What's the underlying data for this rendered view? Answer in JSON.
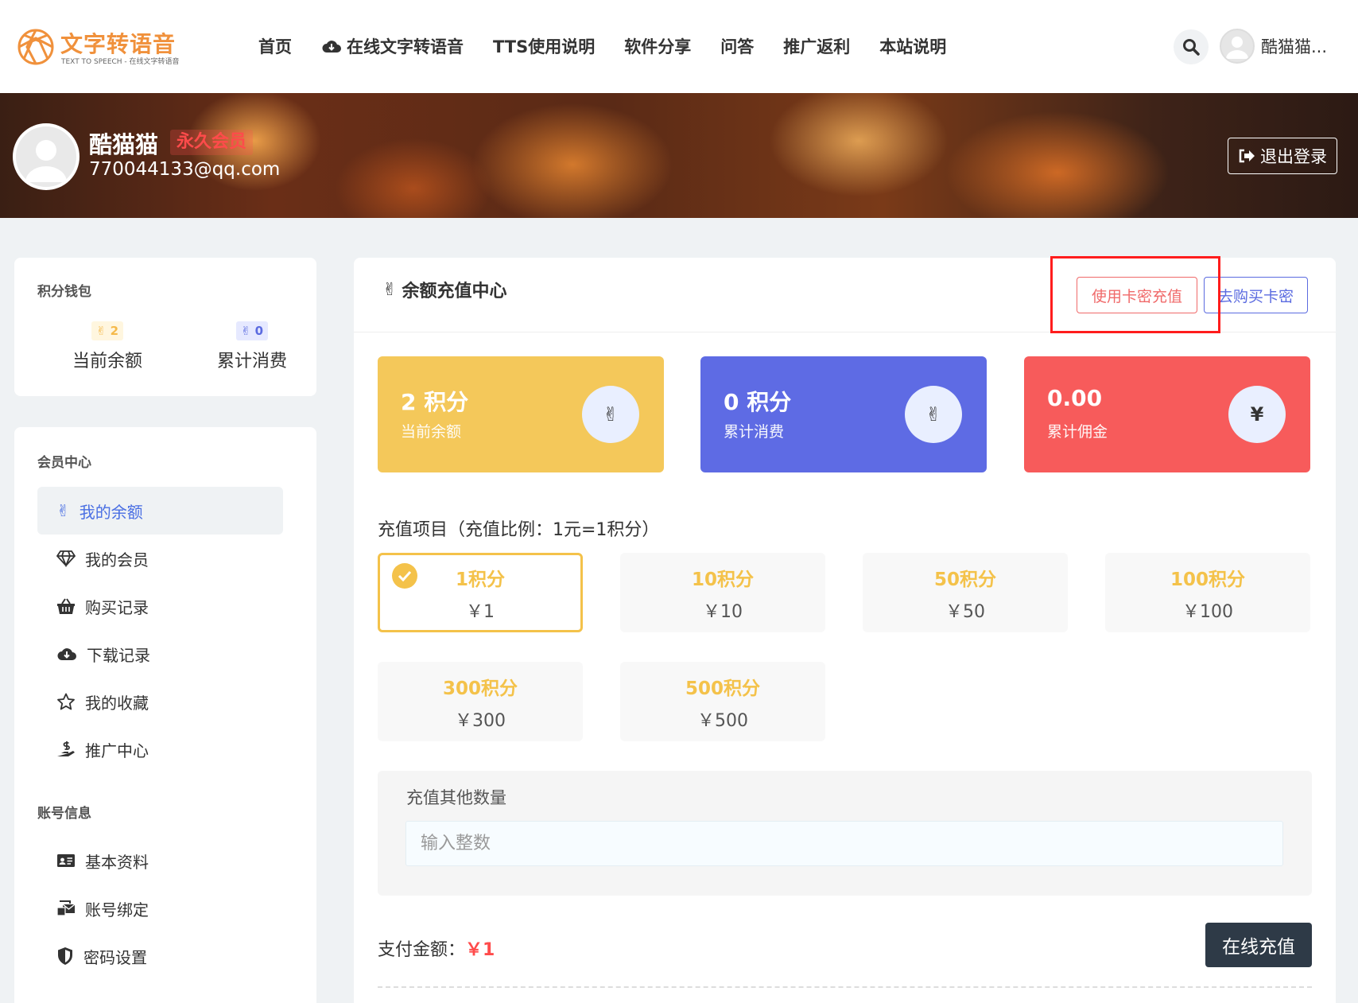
{
  "header": {
    "logo_title": "文字转语音",
    "logo_sub": "TEXT TO SPEECH - 在线文字转语音",
    "nav": [
      "首页",
      "在线文字转语音",
      "TTS使用说明",
      "软件分享",
      "问答",
      "推广返利",
      "本站说明"
    ],
    "user_name": "酷猫猫..."
  },
  "banner": {
    "name": "酷猫猫",
    "vip": "永久会员",
    "email": "770044133@qq.com",
    "logout": "退出登录"
  },
  "wallet": {
    "title": "积分钱包",
    "balance_value": "2",
    "balance_label": "当前余额",
    "spent_value": "0",
    "spent_label": "累计消费"
  },
  "member": {
    "section1": "会员中心",
    "items": [
      "我的余额",
      "我的会员",
      "购买记录",
      "下载记录",
      "我的收藏",
      "推广中心"
    ],
    "section2": "账号信息",
    "items2": [
      "基本资料",
      "账号绑定",
      "密码设置"
    ]
  },
  "main": {
    "title": "余额充值中心",
    "btn_card": "使用卡密充值",
    "btn_buy": "去购买卡密",
    "stats": [
      {
        "value": "2 积分",
        "label": "当前余额",
        "color": "#f4c85a"
      },
      {
        "value": "0 积分",
        "label": "累计消费",
        "color": "#5e6be4"
      },
      {
        "value": "0.00",
        "label": "累计佣金",
        "color": "#f75b5b"
      }
    ],
    "yen_icon": "¥",
    "recharge_label": "充值项目（充值比例：1元=1积分）",
    "options": [
      {
        "points": "1积分",
        "price": "￥1"
      },
      {
        "points": "10积分",
        "price": "￥10"
      },
      {
        "points": "50积分",
        "price": "￥50"
      },
      {
        "points": "100积分",
        "price": "￥100"
      },
      {
        "points": "300积分",
        "price": "￥300"
      },
      {
        "points": "500积分",
        "price": "￥500"
      }
    ],
    "other_label": "充值其他数量",
    "other_placeholder": "输入整数",
    "pay_label": "支付金额：",
    "pay_amount": "￥1",
    "pay_button": "在线充值"
  }
}
